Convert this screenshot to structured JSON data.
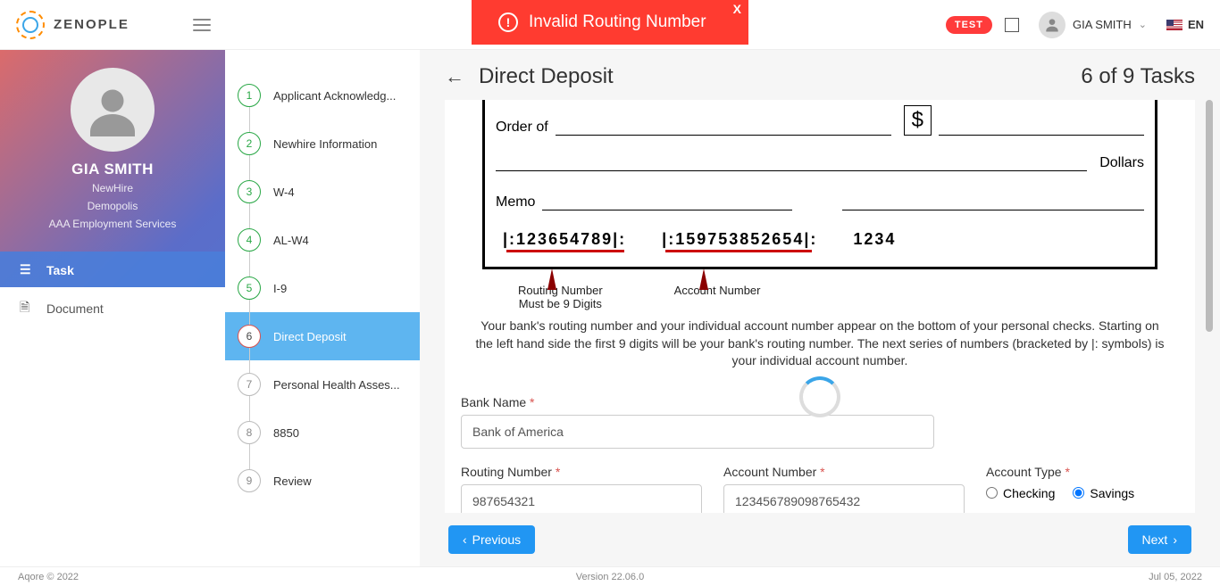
{
  "header": {
    "brand": "ZENOPLE",
    "test_badge": "TEST",
    "user": "GIA SMITH",
    "lang": "EN"
  },
  "error": {
    "message": "Invalid Routing Number",
    "close": "X"
  },
  "profile": {
    "name": "GIA SMITH",
    "role": "NewHire",
    "location": "Demopolis",
    "company": "AAA Employment Services"
  },
  "sideNav": {
    "task": "Task",
    "document": "Document"
  },
  "steps": [
    {
      "num": "1",
      "label": "Applicant Acknowledg..."
    },
    {
      "num": "2",
      "label": "Newhire Information"
    },
    {
      "num": "3",
      "label": "W-4"
    },
    {
      "num": "4",
      "label": "AL-W4"
    },
    {
      "num": "5",
      "label": "I-9"
    },
    {
      "num": "6",
      "label": "Direct Deposit"
    },
    {
      "num": "7",
      "label": "Personal Health Asses..."
    },
    {
      "num": "8",
      "label": "8850"
    },
    {
      "num": "9",
      "label": "Review"
    }
  ],
  "main": {
    "title": "Direct Deposit",
    "task_count": "6 of 9 Tasks"
  },
  "check": {
    "order_of": "Order of",
    "dollar_sign": "$",
    "dollars": "Dollars",
    "memo": "Memo",
    "routing_sample": "|:123654789|:",
    "account_sample": "|:159753852654|:",
    "check_no": "1234",
    "routing_caption1": "Routing Number",
    "routing_caption2": "Must be 9 Digits",
    "account_caption": "Account Number",
    "info": "Your bank's routing number and your individual account number appear on the bottom of your personal checks. Starting on the left hand side the first 9 digits will be your bank's routing number. The next series of numbers (bracketed by |: symbols) is your individual account number."
  },
  "form": {
    "bank_label": "Bank Name",
    "bank_value": "Bank of America",
    "routing_label": "Routing Number",
    "routing_value": "987654321",
    "account_label": "Account Number",
    "account_value": "123456789098765432",
    "type_label": "Account Type",
    "checking": "Checking",
    "savings": "Savings"
  },
  "actions": {
    "prev": "Previous",
    "next": "Next"
  },
  "footer": {
    "left": "Aqore © 2022",
    "center": "Version 22.06.0",
    "right": "Jul 05, 2022"
  }
}
